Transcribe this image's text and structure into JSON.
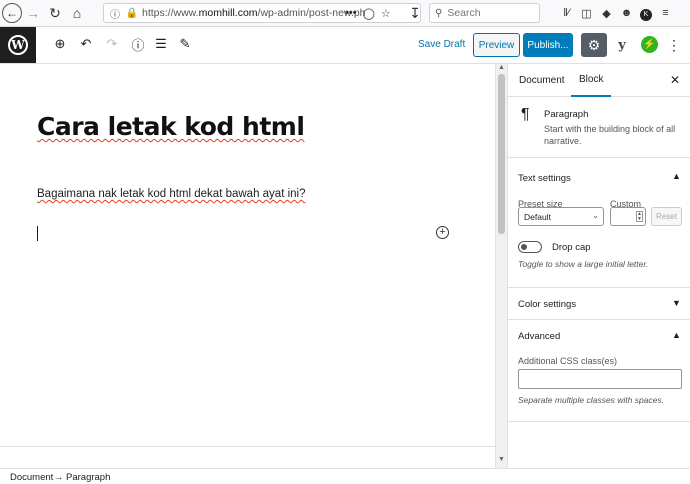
{
  "browser": {
    "url_scheme": "https://www.",
    "url_host": "momhill.com",
    "url_path": "/wp-admin/post-new.ph",
    "search_placeholder": "Search",
    "profile_initial": "K"
  },
  "toolbar": {
    "save_draft_label": "Save Draft",
    "preview_label": "Preview",
    "publish_label": "Publish..."
  },
  "editor": {
    "post_title": "Cara letak kod html",
    "paragraph_text": "Bagaimana nak letak kod html dekat bawah ayat ini?"
  },
  "sidebar": {
    "tabs": [
      {
        "label": "Document",
        "active": false
      },
      {
        "label": "Block",
        "active": true
      }
    ],
    "block_card": {
      "title": "Paragraph",
      "description": "Start with the building block of all narrative."
    },
    "text_settings": {
      "title": "Text settings",
      "preset_label": "Preset size",
      "custom_label": "Custom",
      "preset_value": "Default",
      "reset_label": "Reset",
      "drop_cap_label": "Drop cap",
      "drop_cap_help": "Toggle to show a large initial letter."
    },
    "color_settings": {
      "title": "Color settings"
    },
    "advanced": {
      "title": "Advanced",
      "css_label": "Additional CSS class(es)",
      "css_help": "Separate multiple classes with spaces."
    }
  },
  "breadcrumb": {
    "items": [
      "Document",
      "→",
      "Paragraph"
    ]
  },
  "colors": {
    "primary": "#007cba",
    "admin_dark": "#1e1e1e",
    "jetpack_green": "#2fb41f",
    "settings_gray": "#555d66"
  }
}
